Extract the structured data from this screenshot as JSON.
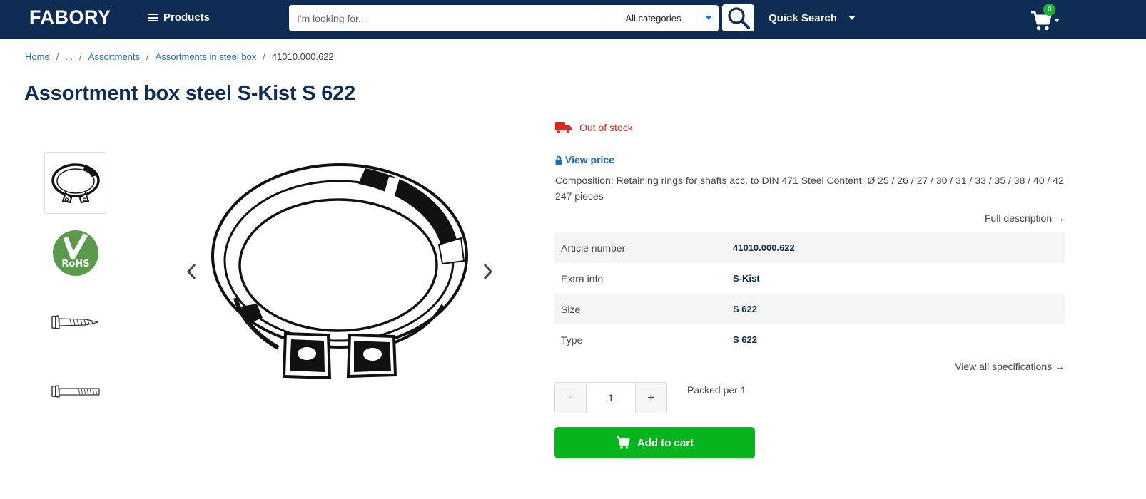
{
  "header": {
    "logo": "FABORY",
    "products_label": "Products",
    "search_placeholder": "I'm looking for...",
    "category_selected": "All categories",
    "quick_search_label": "Quick Search",
    "cart_count": "0"
  },
  "breadcrumb": {
    "items": [
      "Home",
      "...",
      "Assortments",
      "Assortments in steel box"
    ],
    "current": "41010.000.622"
  },
  "product": {
    "title": "Assortment box steel S-Kist S 622",
    "stock_status": "Out of stock",
    "view_price_label": "View price",
    "composition_line1": "Composition: Retaining rings for shafts acc. to DIN 471 Steel Content: Ø 25 / 26 / 27 / 30 / 31 / 33 / 35 / 38 / 40 / 42",
    "composition_line2": "247 pieces",
    "full_description_label": "Full description →",
    "specs": [
      {
        "key": "Article number",
        "value": "41010.000.622"
      },
      {
        "key": "Extra info",
        "value": "S-Kist"
      },
      {
        "key": "Size",
        "value": "S 622"
      },
      {
        "key": "Type",
        "value": "S 622"
      }
    ],
    "view_all_specs_label": "View all specifications →",
    "quantity": "1",
    "minus_label": "-",
    "plus_label": "+",
    "packed_label": "Packed per 1",
    "add_to_cart_label": "Add to cart"
  },
  "thumbnails": {
    "rohs_label": "RoHS"
  },
  "colors": {
    "header_bg": "#0f2c54",
    "link": "#1d6fb8",
    "out_of_stock": "#d82a20",
    "add_to_cart": "#06b51e",
    "badge": "#14b52c"
  },
  "icons": [
    "hamburger-icon",
    "chevron-down-icon",
    "search-icon",
    "cart-icon",
    "truck-icon",
    "lock-icon",
    "chevron-left-icon",
    "chevron-right-icon"
  ]
}
